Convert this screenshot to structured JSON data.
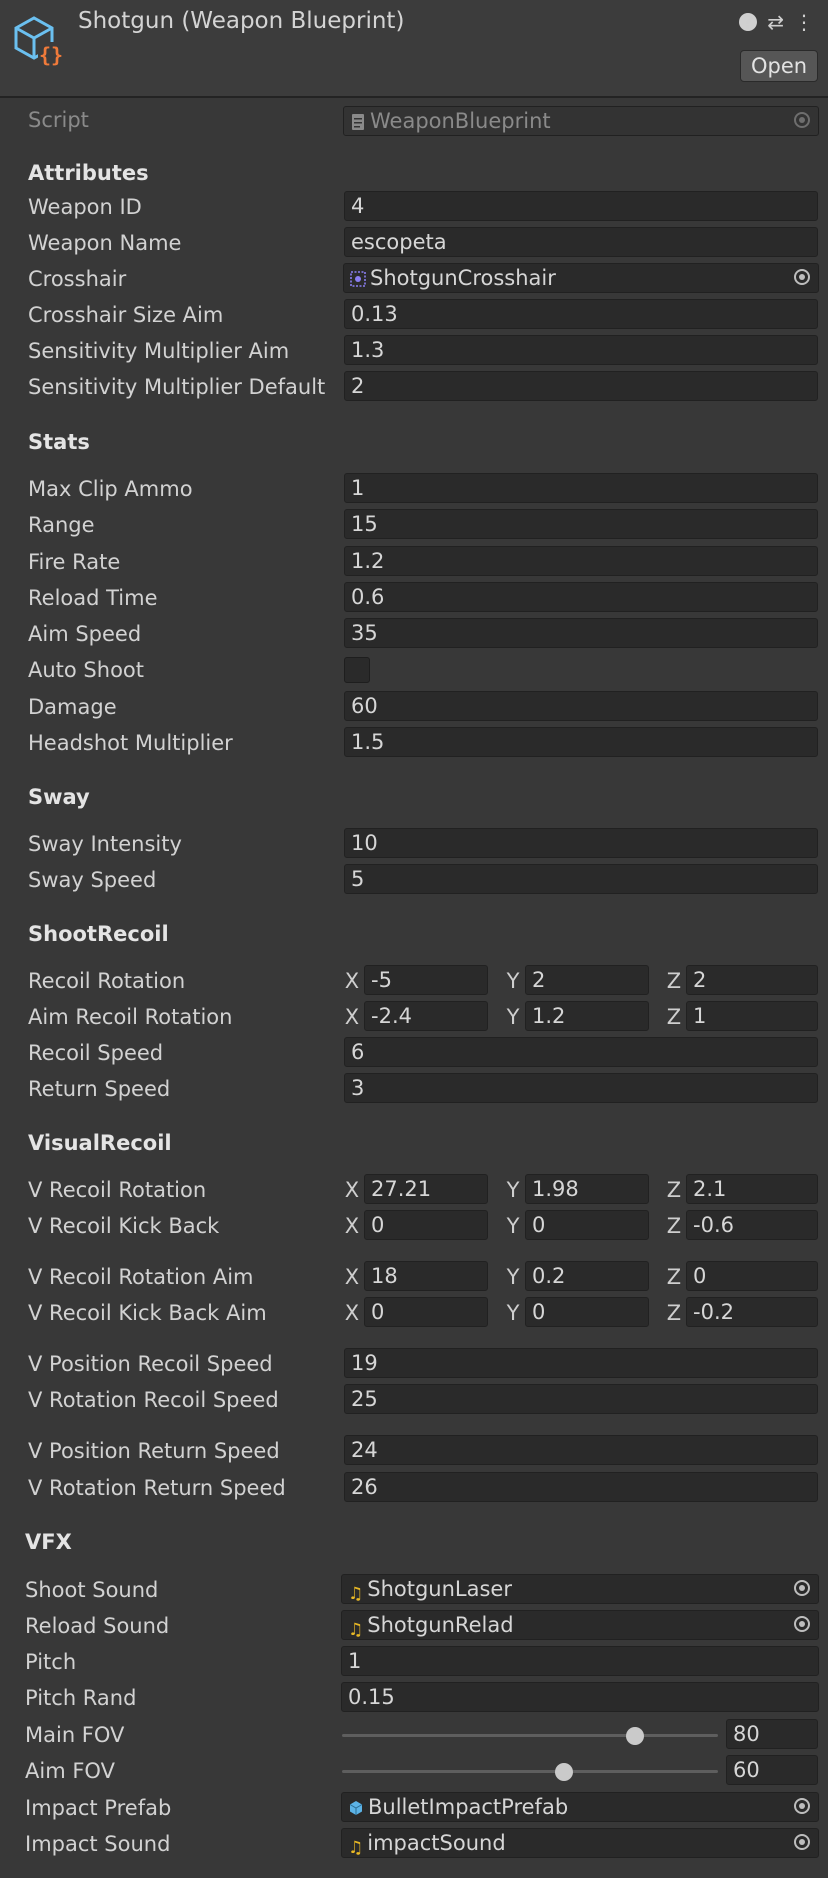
{
  "header": {
    "title": "Shotgun (Weapon Blueprint)",
    "open_label": "Open",
    "icon": "scriptable-object-icon"
  },
  "script": {
    "label": "Script",
    "value": "WeaponBlueprint"
  },
  "attributes": {
    "title": "Attributes",
    "weapon_id": {
      "label": "Weapon ID",
      "value": "4"
    },
    "weapon_name": {
      "label": "Weapon Name",
      "value": "escopeta"
    },
    "crosshair": {
      "label": "Crosshair",
      "value": "ShotgunCrosshair"
    },
    "crosshair_size_aim": {
      "label": "Crosshair Size Aim",
      "value": "0.13"
    },
    "sens_aim": {
      "label": "Sensitivity Multiplier Aim",
      "value": "1.3"
    },
    "sens_default": {
      "label": "Sensitivity Multiplier Default",
      "value": "2"
    }
  },
  "stats": {
    "title": "Stats",
    "max_clip": {
      "label": "Max Clip Ammo",
      "value": "1"
    },
    "range": {
      "label": "Range",
      "value": "15"
    },
    "fire_rate": {
      "label": "Fire Rate",
      "value": "1.2"
    },
    "reload_time": {
      "label": "Reload Time",
      "value": "0.6"
    },
    "aim_speed": {
      "label": "Aim Speed",
      "value": "35"
    },
    "auto_shoot": {
      "label": "Auto Shoot",
      "checked": false
    },
    "damage": {
      "label": "Damage",
      "value": "60"
    },
    "headshot": {
      "label": "Headshot Multiplier",
      "value": "1.5"
    }
  },
  "sway": {
    "title": "Sway",
    "intensity": {
      "label": "Sway Intensity",
      "value": "10"
    },
    "speed": {
      "label": "Sway Speed",
      "value": "5"
    }
  },
  "shoot_recoil": {
    "title": "ShootRecoil",
    "recoil_rotation": {
      "label": "Recoil Rotation",
      "x": "-5",
      "y": "2",
      "z": "2"
    },
    "aim_recoil_rotation": {
      "label": "Aim Recoil Rotation",
      "x": "-2.4",
      "y": "1.2",
      "z": "1"
    },
    "recoil_speed": {
      "label": "Recoil Speed",
      "value": "6"
    },
    "return_speed": {
      "label": "Return Speed",
      "value": "3"
    }
  },
  "visual_recoil": {
    "title": "VisualRecoil",
    "v_rot": {
      "label": "V Recoil Rotation",
      "x": "27.21",
      "y": "1.98",
      "z": "2.1"
    },
    "v_kick": {
      "label": "V Recoil Kick Back",
      "x": "0",
      "y": "0",
      "z": "-0.6"
    },
    "v_rot_aim": {
      "label": "V Recoil Rotation Aim",
      "x": "18",
      "y": "0.2",
      "z": "0"
    },
    "v_kick_aim": {
      "label": "V Recoil Kick Back Aim",
      "x": "0",
      "y": "0",
      "z": "-0.2"
    },
    "v_pos_speed": {
      "label": "V Position Recoil Speed",
      "value": "19"
    },
    "v_rot_speed": {
      "label": "V Rotation Recoil Speed",
      "value": "25"
    },
    "v_pos_return": {
      "label": "V Position Return Speed",
      "value": "24"
    },
    "v_rot_return": {
      "label": "V Rotation Return Speed",
      "value": "26"
    }
  },
  "vfx": {
    "title": "VFX",
    "shoot_sound": {
      "label": "Shoot Sound",
      "value": "ShotgunLaser"
    },
    "reload_sound": {
      "label": "Reload Sound",
      "value": "ShotgunRelad"
    },
    "pitch": {
      "label": "Pitch",
      "value": "1"
    },
    "pitch_rand": {
      "label": "Pitch Rand",
      "value": "0.15"
    },
    "main_fov": {
      "label": "Main FOV",
      "value": "80",
      "fraction": 0.78
    },
    "aim_fov": {
      "label": "Aim FOV",
      "value": "60",
      "fraction": 0.59
    },
    "impact_prefab": {
      "label": "Impact Prefab",
      "value": "BulletImpactPrefab"
    },
    "impact_sound": {
      "label": "Impact Sound",
      "value": "impactSound"
    }
  },
  "axis_labels": {
    "x": "X",
    "y": "Y",
    "z": "Z"
  },
  "colors": {
    "background": "#383838",
    "field": "#2a2a2a",
    "audio_icon": "#e8b825",
    "prefab_icon": "#5cb3e6",
    "crosshair_icon": "#8a7ef0"
  }
}
